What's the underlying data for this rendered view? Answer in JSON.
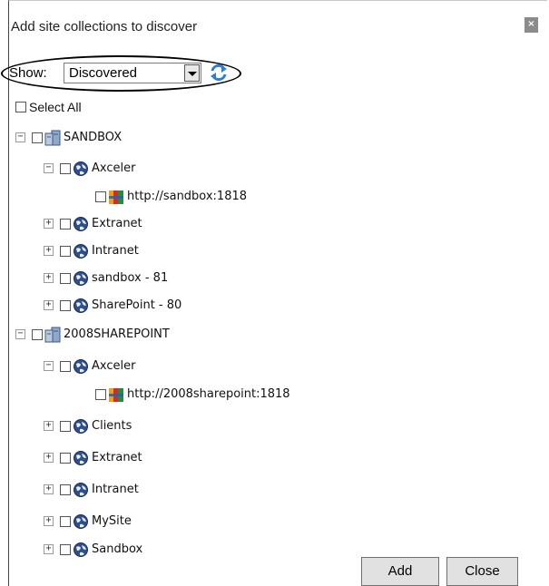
{
  "dialog": {
    "title": "Add site collections to discover",
    "close_glyph": "×"
  },
  "filter": {
    "label": "Show:",
    "selected": "Discovered"
  },
  "select_all_label": "Select All",
  "tree": {
    "n0": "SANDBOX",
    "n1": "Axceler",
    "n2": "http://sandbox:1818",
    "n3": "Extranet",
    "n4": "Intranet",
    "n5": "sandbox - 81",
    "n6": "SharePoint - 80",
    "n7": "2008SHAREPOINT",
    "n8": "Axceler",
    "n9": "http://2008sharepoint:1818",
    "n10": "Clients",
    "n11": "Extranet",
    "n12": "Intranet",
    "n13": "MySite",
    "n14": "Sandbox"
  },
  "tree_meta": {
    "expanders": {
      "n0": "−",
      "n1": "−",
      "n3": "+",
      "n4": "+",
      "n5": "+",
      "n6": "+",
      "n7": "−",
      "n8": "−",
      "n10": "+",
      "n11": "+",
      "n12": "+",
      "n13": "+",
      "n14": "+"
    },
    "icons": {
      "n0": "server-icon",
      "n1": "globe-icon",
      "n2": "site-collection-icon",
      "n3": "globe-icon",
      "n4": "globe-icon",
      "n5": "globe-icon",
      "n6": "globe-icon",
      "n7": "server-icon",
      "n8": "globe-icon",
      "n9": "site-collection-icon",
      "n10": "globe-icon",
      "n11": "globe-icon",
      "n12": "globe-icon",
      "n13": "globe-icon",
      "n14": "globe-icon"
    }
  },
  "buttons": {
    "add": "Add",
    "close": "Close"
  }
}
